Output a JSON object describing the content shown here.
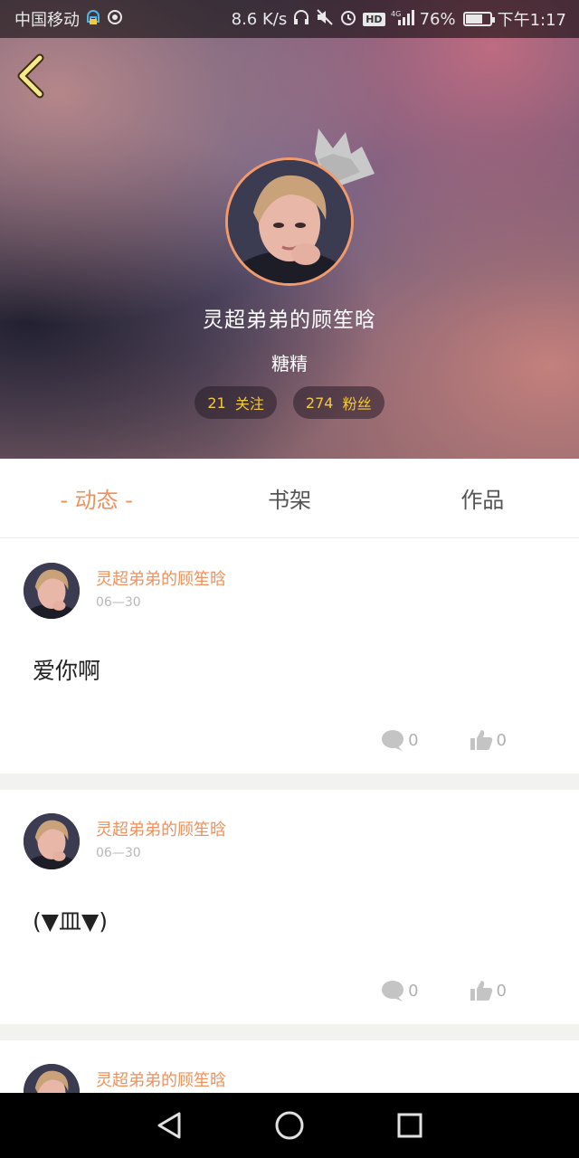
{
  "status_bar": {
    "carrier": "中国移动",
    "speed": "8.6 K/s",
    "network": "4G",
    "battery_percent": "76%",
    "battery_level": 0.76,
    "time": "下午1:17"
  },
  "profile": {
    "name": "灵超弟弟的顾笙晗",
    "subtitle": "糖精",
    "following_count": "21",
    "following_label": "关注",
    "followers_count": "274",
    "followers_label": "粉丝"
  },
  "tabs": [
    {
      "label": "动态",
      "active": true
    },
    {
      "label": "书架",
      "active": false
    },
    {
      "label": "作品",
      "active": false
    }
  ],
  "posts": [
    {
      "author": "灵超弟弟的顾笙晗",
      "date": "06—30",
      "text": "爱你啊",
      "comments": "0",
      "likes": "0"
    },
    {
      "author": "灵超弟弟的顾笙晗",
      "date": "06—30",
      "text": "(▼皿▼)",
      "comments": "0",
      "likes": "0"
    },
    {
      "author": "灵超弟弟的顾笙晗",
      "date": "",
      "text": "",
      "comments": "",
      "likes": ""
    }
  ],
  "colors": {
    "accent": "#f0905a",
    "stat_text": "#f3c93d",
    "divider": "#f2f2ee"
  }
}
